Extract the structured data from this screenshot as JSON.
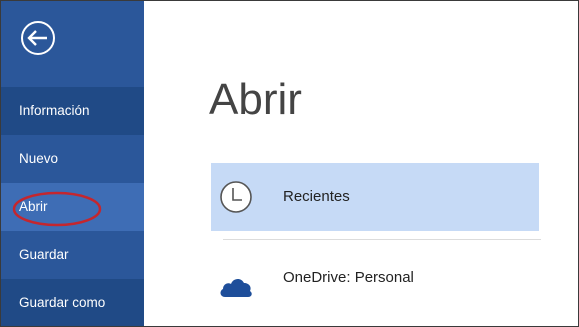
{
  "sidebar": {
    "back_icon": "back-arrow-circle-icon",
    "items": [
      {
        "label": "Información"
      },
      {
        "label": "Nuevo"
      },
      {
        "label": "Abrir"
      },
      {
        "label": "Guardar"
      },
      {
        "label": "Guardar como"
      }
    ]
  },
  "main": {
    "title": "Abrir",
    "locations": [
      {
        "label": "Recientes",
        "icon": "clock-icon",
        "selected": true
      },
      {
        "label": "OneDrive: Personal",
        "icon": "cloud-icon",
        "selected": false
      }
    ]
  },
  "colors": {
    "sidebar_bg": "#2b579a",
    "sidebar_dark": "#204a86",
    "sidebar_hover": "#3e6db5",
    "selection_bg": "#c6daf6",
    "highlight_ellipse": "#c4262e",
    "cloud": "#1e4e9a"
  }
}
